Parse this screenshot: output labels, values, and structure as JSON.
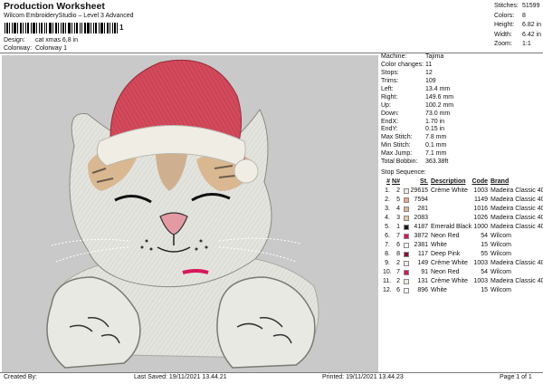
{
  "header": {
    "title": "Production Worksheet",
    "subtitle": "Wilcom EmbroideryStudio – Level 3 Advanced",
    "barcode_text": "1",
    "design_label": "Design:",
    "design_value": "cat xmas 6,8 in",
    "colorway_label": "Colorway:",
    "colorway_value": "Colorway 1"
  },
  "stats": [
    {
      "label": "Stitches:",
      "value": "51599"
    },
    {
      "label": "Colors:",
      "value": "8"
    },
    {
      "label": "Height:",
      "value": "6.82 in"
    },
    {
      "label": "Width:",
      "value": "6.42 in"
    },
    {
      "label": "Zoom:",
      "value": "1:1"
    }
  ],
  "design_info": [
    {
      "label": "Machine:",
      "value": "Tajima"
    },
    {
      "label": "Color changes:",
      "value": "11"
    },
    {
      "label": "Stops:",
      "value": "12"
    },
    {
      "label": "Trims:",
      "value": "109"
    },
    {
      "label": "Left:",
      "value": "13.4 mm"
    },
    {
      "label": "Right:",
      "value": "149.6 mm"
    },
    {
      "label": "Up:",
      "value": "100.2 mm"
    },
    {
      "label": "Down:",
      "value": "73.0 mm"
    },
    {
      "label": "EndX:",
      "value": "1.70 in"
    },
    {
      "label": "EndY:",
      "value": "0.15 in"
    },
    {
      "label": "Max Stitch:",
      "value": "7.8 mm"
    },
    {
      "label": "Min Stitch:",
      "value": "0.1 mm"
    },
    {
      "label": "Max Jump:",
      "value": "7.1 mm"
    },
    {
      "label": "Total Bobbin:",
      "value": "363.38ft"
    }
  ],
  "stop_sequence": {
    "title": "Stop Sequence:",
    "headers": {
      "num": "#",
      "nn": "N#",
      "st": "St.",
      "desc": "Description",
      "code": "Code",
      "brand": "Brand"
    },
    "rows": [
      {
        "num": "1.",
        "nn": "2",
        "color": "#f1ece2",
        "st": "29615",
        "desc": "Crème White",
        "code": "1003",
        "brand": "Madeira Classic 40"
      },
      {
        "num": "2.",
        "nn": "5",
        "color": "#e9a98a",
        "st": "7594",
        "desc": "",
        "code": "1149",
        "brand": "Madeira Classic 40"
      },
      {
        "num": "3.",
        "nn": "4",
        "color": "#d8b89a",
        "st": "281",
        "desc": "",
        "code": "1016",
        "brand": "Madeira Classic 40"
      },
      {
        "num": "4.",
        "nn": "3",
        "color": "#e3c6a8",
        "st": "2083",
        "desc": "",
        "code": "1026",
        "brand": "Madeira Classic 40"
      },
      {
        "num": "5.",
        "nn": "1",
        "color": "#1a1a1a",
        "st": "4187",
        "desc": "Emerald Black",
        "code": "1000",
        "brand": "Madeira Classic 40"
      },
      {
        "num": "6.",
        "nn": "7",
        "color": "#d6185a",
        "st": "3872",
        "desc": "Neon Red",
        "code": "54",
        "brand": "Wilcom"
      },
      {
        "num": "7.",
        "nn": "6",
        "color": "#ffffff",
        "st": "2381",
        "desc": "White",
        "code": "15",
        "brand": "Wilcom"
      },
      {
        "num": "8.",
        "nn": "8",
        "color": "#8a1030",
        "st": "117",
        "desc": "Deep Pink",
        "code": "55",
        "brand": "Wilcom"
      },
      {
        "num": "9.",
        "nn": "2",
        "color": "#f1ece2",
        "st": "149",
        "desc": "Crème White",
        "code": "1003",
        "brand": "Madeira Classic 40"
      },
      {
        "num": "10.",
        "nn": "7",
        "color": "#d6185a",
        "st": "91",
        "desc": "Neon Red",
        "code": "54",
        "brand": "Wilcom"
      },
      {
        "num": "11.",
        "nn": "2",
        "color": "#f1ece2",
        "st": "131",
        "desc": "Crème White",
        "code": "1003",
        "brand": "Madeira Classic 40"
      },
      {
        "num": "12.",
        "nn": "6",
        "color": "#ffffff",
        "st": "896",
        "desc": "White",
        "code": "15",
        "brand": "Wilcom"
      }
    ]
  },
  "footer": {
    "created_by": "Created By:",
    "last_saved": "Last Saved: 19/11/2021 13.44.21",
    "printed": "Printed: 19/11/2021 13.44.23",
    "page": "Page 1 of 1"
  },
  "colors": {
    "canvas_bg": "#c9c9c9",
    "hat_red": "#d24a5c",
    "hat_trim": "#f0ede5",
    "fur_white": "#e4e4df",
    "fur_tan": "#d8b28a",
    "nose_pink": "#e39aa3",
    "collar_red": "#d6185a"
  }
}
